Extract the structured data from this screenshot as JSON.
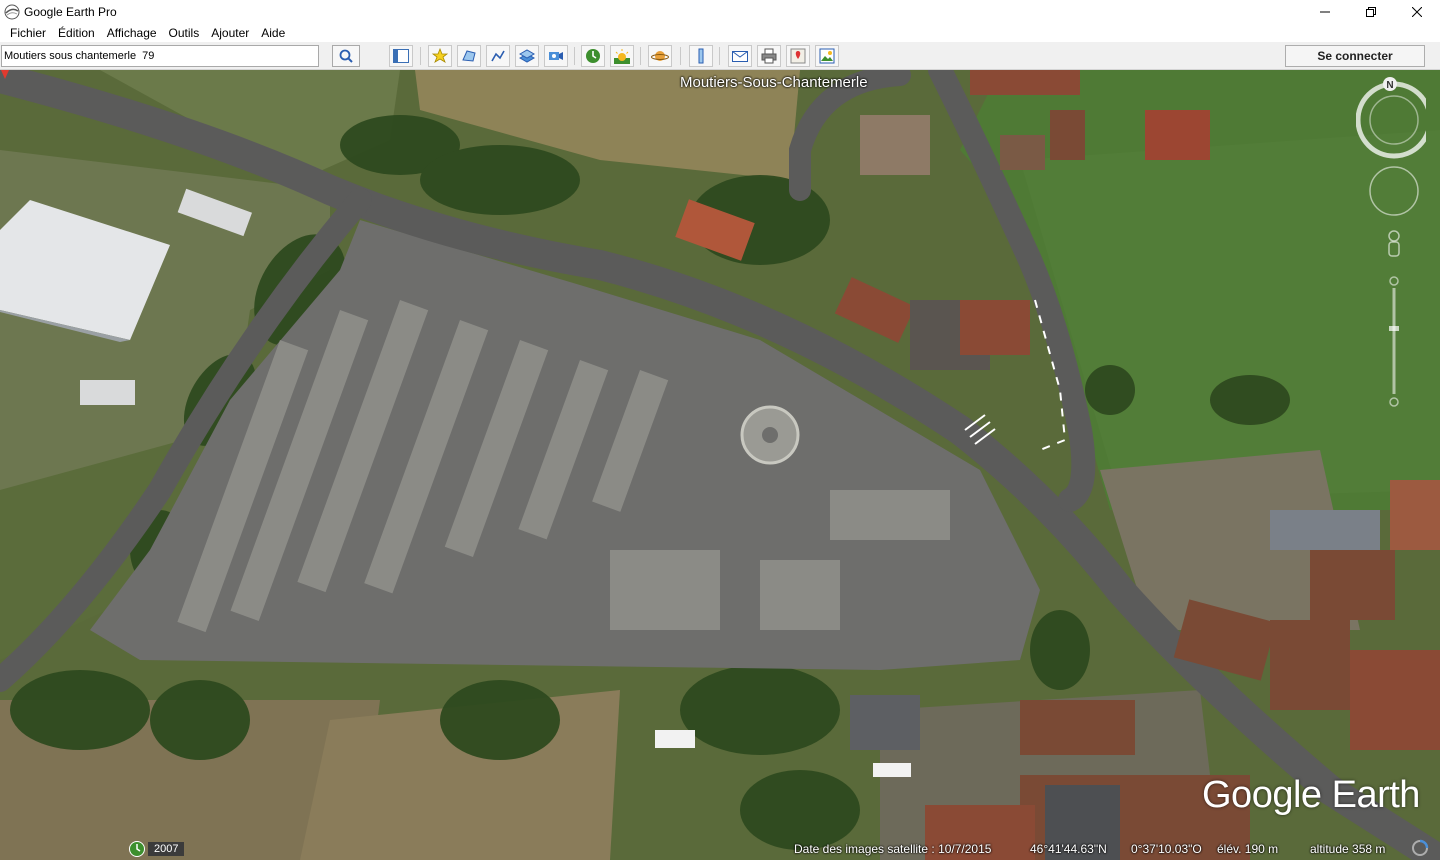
{
  "window": {
    "title": "Google Earth Pro",
    "controls": [
      "minimize",
      "restore",
      "close"
    ]
  },
  "menu": {
    "items": [
      "Fichier",
      "Édition",
      "Affichage",
      "Outils",
      "Ajouter",
      "Aide"
    ]
  },
  "toolbar": {
    "search_value": "Moutiers sous chantemerle  79",
    "buttons": [
      "sidebar-icon",
      "placemark-icon",
      "polygon-icon",
      "path-icon",
      "overlay-icon",
      "record-tour-icon",
      "historical-imagery-icon",
      "sunlight-icon",
      "planets-icon",
      "ruler-icon",
      "email-icon",
      "print-icon",
      "google-maps-icon",
      "save-image-icon"
    ],
    "connect_label": "Se connecter"
  },
  "map": {
    "place_label": "Moutiers-Sous-Chantemerle",
    "logo_text": "Google Earth",
    "compass_north": "N"
  },
  "status": {
    "history_year": "2007",
    "imagery_date": "Date des images satellite : 10/7/2015",
    "latitude": "46°41'44.63\"N",
    "longitude": "0°37'10.03\"O",
    "elevation": "élév.  190 m",
    "altitude": "altitude   358 m"
  },
  "colors": {
    "field_green": "#4f6b2e",
    "road_gray": "#5b5b5b",
    "cemetery_gray": "#6e6e6e",
    "roof_red": "#8a4a35"
  }
}
